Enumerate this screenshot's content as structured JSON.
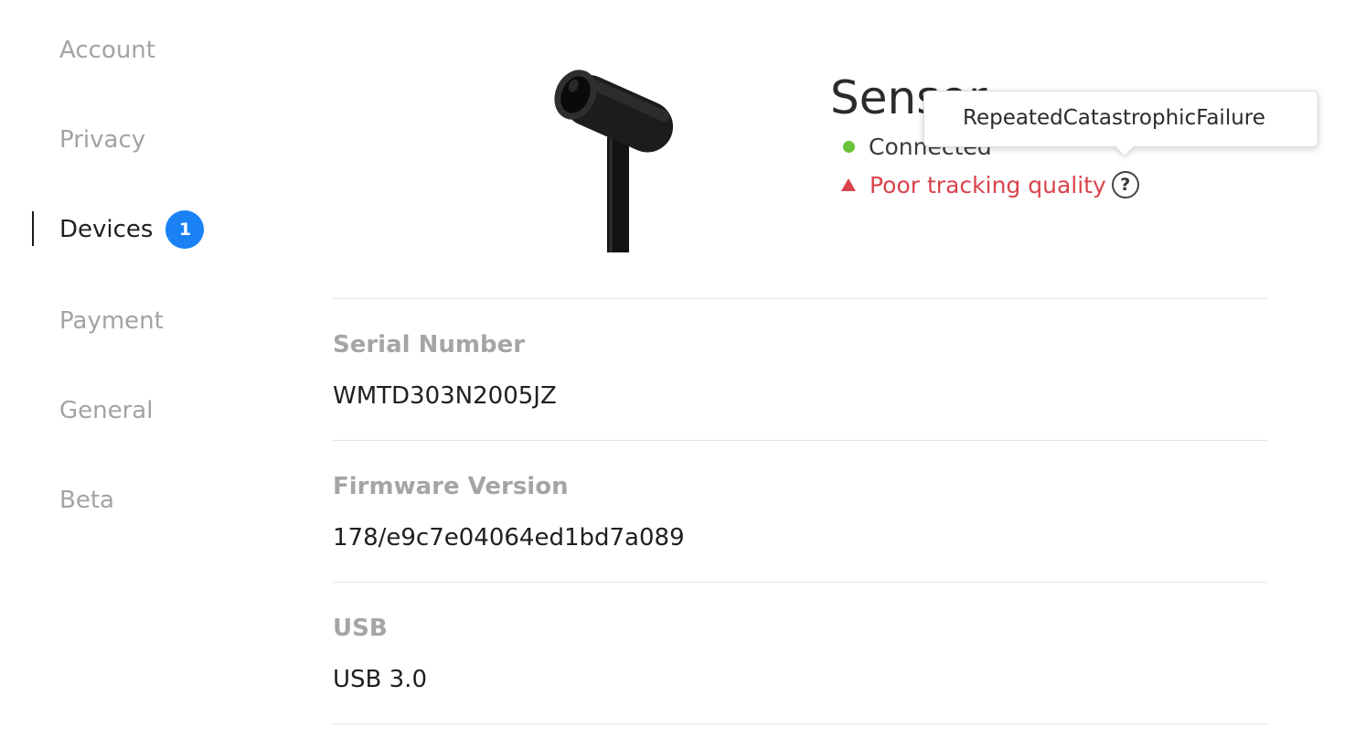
{
  "sidebar": {
    "items": [
      {
        "label": "Account"
      },
      {
        "label": "Privacy"
      },
      {
        "label": "Devices",
        "badge": "1",
        "active": true
      },
      {
        "label": "Payment"
      },
      {
        "label": "General"
      },
      {
        "label": "Beta"
      }
    ]
  },
  "device": {
    "title": "Sensor",
    "image_icon": "sensor-camera",
    "status_connected": "Connected",
    "status_warning": "Poor tracking quality",
    "help_icon": "?"
  },
  "tooltip": {
    "text": "RepeatedCatastrophicFailure"
  },
  "details": {
    "serial_label": "Serial Number",
    "serial_value": "WMTD303N2005JZ",
    "firmware_label": "Firmware Version",
    "firmware_value": "178/e9c7e04064ed1bd7a089",
    "usb_label": "USB",
    "usb_value": "USB 3.0"
  },
  "colors": {
    "badge": "#1a82f5",
    "connected": "#69c23a",
    "warning": "#d9434c"
  }
}
